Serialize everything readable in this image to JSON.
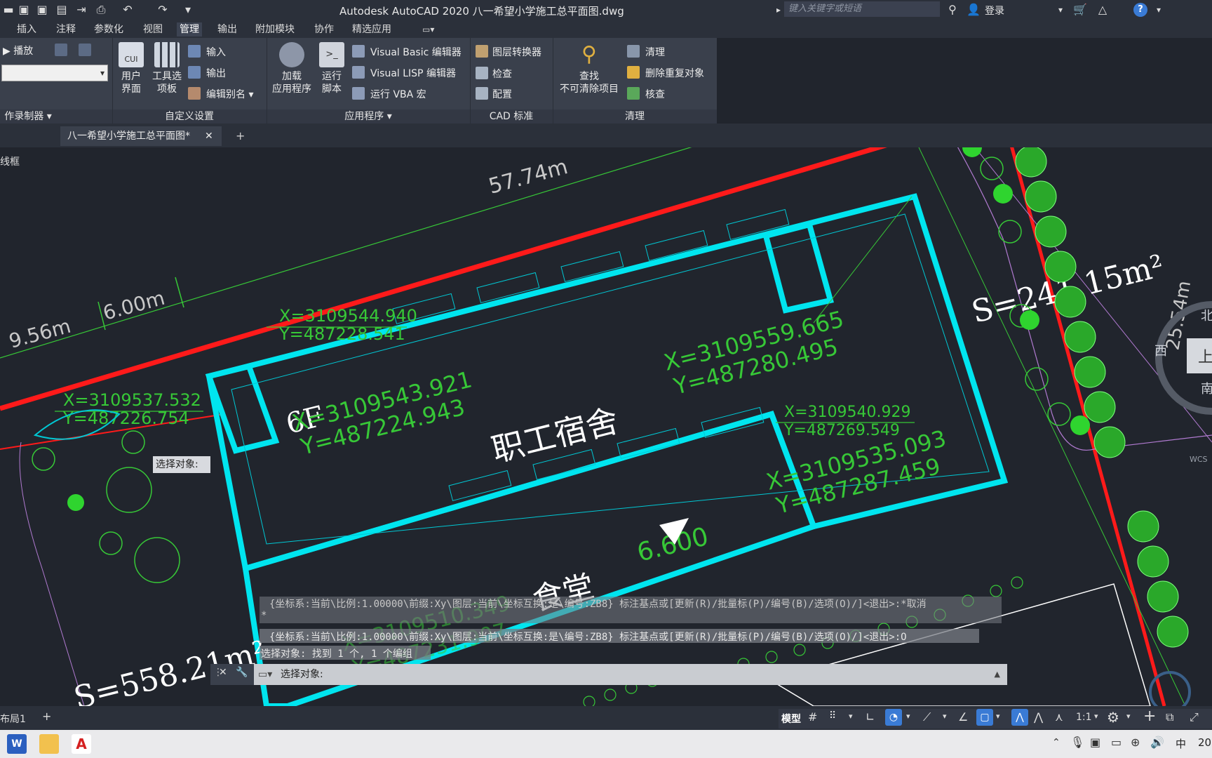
{
  "titlebar": {
    "app_title": "Autodesk AutoCAD 2020    八一希望小学施工总平面图.dwg",
    "search_placeholder": "键入关键字或短语",
    "login_label": "登录"
  },
  "menu": {
    "tabs": [
      "插入",
      "注释",
      "参数化",
      "视图",
      "管理",
      "输出",
      "附加模块",
      "协作",
      "精选应用"
    ],
    "active": "管理"
  },
  "ribbon": {
    "action_recorder": {
      "play": "播放",
      "panel_label": "作录制器"
    },
    "customize": {
      "cui": "用户界面",
      "cui_badge": "CUI",
      "tool_palettes": "工具选项板",
      "import": "输入",
      "export": "输出",
      "edit_aliases": "编辑别名",
      "panel_label": "自定义设置"
    },
    "applications": {
      "load_app": "加载\n应用程序",
      "run_script": "运行\n脚本",
      "vb_editor": "Visual Basic 编辑器",
      "vlisp_editor": "Visual LISP 编辑器",
      "run_vba": "运行 VBA 宏",
      "panel_label": "应用程序"
    },
    "cad_standards": {
      "layer_translator": "图层转换器",
      "check": "检查",
      "configure": "配置",
      "panel_label": "CAD 标准"
    },
    "cleanup": {
      "find_non_purgeable": "查找\n不可清除项目",
      "purge": "清理",
      "overkill": "删除重复对象",
      "audit": "核查",
      "panel_label": "清理"
    }
  },
  "document": {
    "tab_title": "八一希望小学施工总平面图*",
    "viewport_label": "线框"
  },
  "drawing": {
    "dim_top": "57.74m",
    "dim_left1": "9.56m",
    "dim_left2": "6.00m",
    "dim_right": "25.54m",
    "area_right": "S=241.15m²",
    "area_bottom": "S=558.21m²",
    "building_name": "职工宿舍",
    "canteen_name": "食堂",
    "floors": "6F",
    "elevation": "6.600",
    "coords": [
      {
        "x": "X=3109544.940",
        "y": "Y=487228.541"
      },
      {
        "x": "X=3109537.532",
        "y": "Y=487226.754"
      },
      {
        "x": "X=3109543.921",
        "y": "Y=487224.943"
      },
      {
        "x": "X=3109559.665",
        "y": "Y=487280.495"
      },
      {
        "x": "X=3109540.929",
        "y": "Y=487269.549"
      },
      {
        "x": "X=3109535.093",
        "y": "Y=487287.459"
      },
      {
        "x": "X=3109510.349",
        "y": "Y=487231.907"
      }
    ],
    "tooltip": "选择对象:",
    "viewcube": {
      "north": "北",
      "west": "西",
      "south": "南",
      "top": "上",
      "wcs": "WCS"
    }
  },
  "command": {
    "history1": "{坐标系:当前\\比例:1.00000\\前缀:Xy\\图层:当前\\坐标互换:是\\编号:ZB8} 标注基点或[更新(R)/批量标(P)/编号(B)/选项(O)/]<退出>:*取消",
    "history1_cont": "*",
    "history2": "{坐标系:当前\\比例:1.00000\\前缀:Xy\\图层:当前\\坐标互换:是\\编号:ZB8} 标注基点或[更新(R)/批量标(P)/编号(B)/选项(O)/]<退出>:O",
    "history3": "选择对象: 找到 1 个, 1 个编组",
    "prompt": "选择对象:"
  },
  "statusbar": {
    "layout_tab": "布局1",
    "model": "模型",
    "scale": "1:1"
  },
  "taskbar": {
    "ime": "中",
    "clock": "20"
  },
  "colors": {
    "building": "#00e5ef",
    "annotation": "#37c837",
    "redline": "#ff1a1a",
    "text_white": "#ffffff"
  }
}
